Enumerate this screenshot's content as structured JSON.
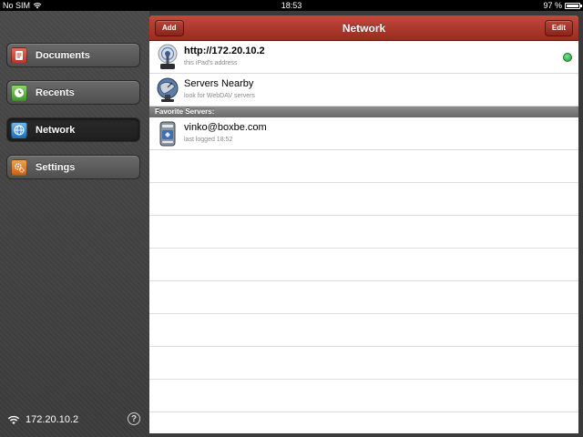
{
  "statusbar": {
    "carrier": "No SIM",
    "time": "18:53",
    "battery": "97 %",
    "battery_level": 0.97
  },
  "sidebar": {
    "items": [
      {
        "label": "Documents",
        "icon": "documents-icon"
      },
      {
        "label": "Recents",
        "icon": "clock-icon"
      },
      {
        "label": "Network",
        "icon": "globe-icon",
        "selected": true
      },
      {
        "label": "Settings",
        "icon": "gears-icon"
      }
    ],
    "footer_ip": "172.20.10.2",
    "help_label": "?"
  },
  "main": {
    "title": "Network",
    "add_label": "Add",
    "edit_label": "Edit",
    "rows": [
      {
        "primary": "http://172.20.10.2",
        "secondary": "this iPad's address",
        "icon": "server-broadcast-icon",
        "status": "online"
      },
      {
        "primary": "Servers Nearby",
        "secondary": "look for WebDAV servers",
        "icon": "satellite-dish-icon"
      }
    ],
    "section_header": "Favorite Servers:",
    "favorites": [
      {
        "primary": "vinko@boxbe.com",
        "secondary": "last logged 18:52",
        "icon": "drive-icon"
      }
    ]
  },
  "colors": {
    "navbar_red": "#a8332a",
    "status_green": "#2fae45",
    "sidebar_dark": "#3c3c3c"
  }
}
